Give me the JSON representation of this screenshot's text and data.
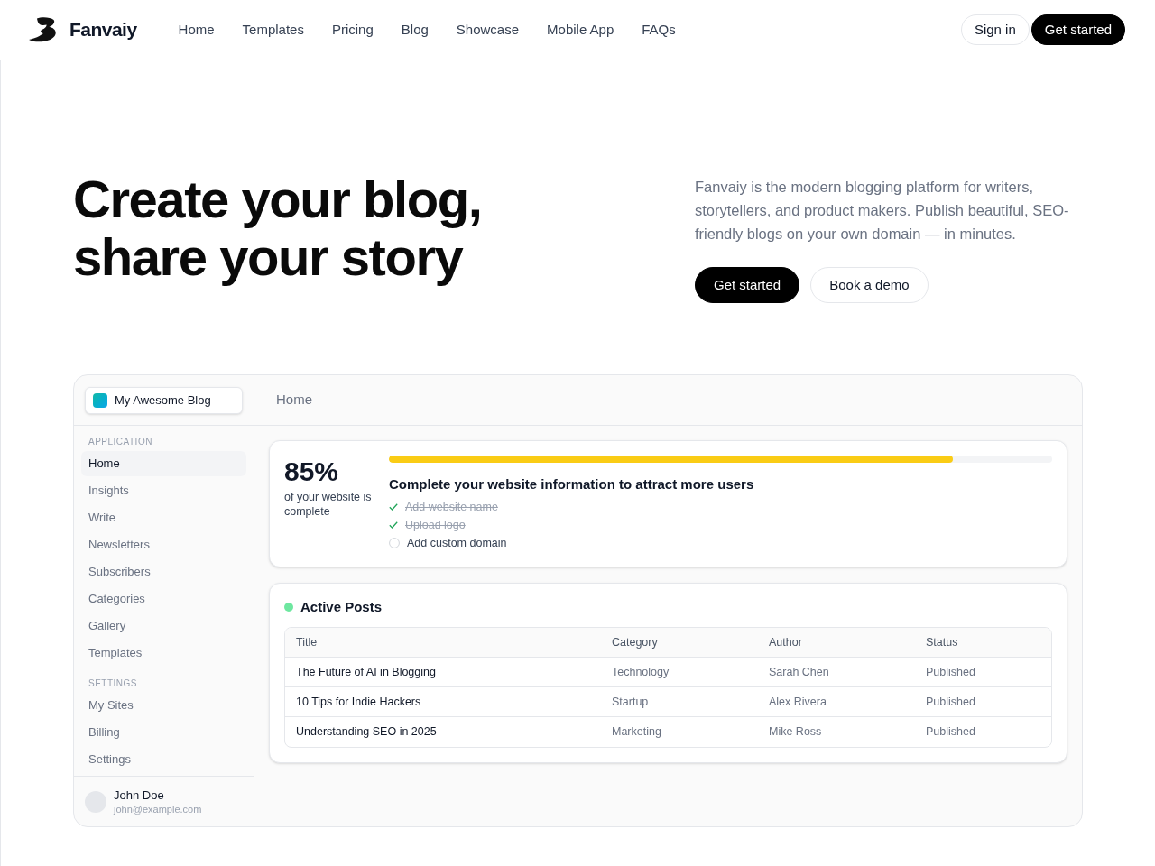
{
  "nav": {
    "brand": "Fanvaiy",
    "links": [
      "Home",
      "Templates",
      "Pricing",
      "Blog",
      "Showcase",
      "Mobile App",
      "FAQs"
    ],
    "actions": [
      {
        "label": "Sign in",
        "kind": "secondary"
      },
      {
        "label": "Get started",
        "kind": "primary"
      }
    ]
  },
  "hero": {
    "title_lines": [
      "Create your blog,",
      "share your story"
    ],
    "description": "Fanvaiy is the modern blogging platform for writers, storytellers, and product makers. Publish beautiful, SEO-friendly blogs on your own domain — in minutes.",
    "buttons": [
      {
        "label": "Get started",
        "kind": "primary"
      },
      {
        "label": "Book a demo",
        "kind": "secondary"
      }
    ]
  },
  "dashboard": {
    "site_picker": {
      "label": "My Awesome Blog"
    },
    "sidebar": {
      "sections": [
        {
          "heading": "APPLICATION",
          "items": [
            {
              "label": "Home",
              "selected": true
            },
            {
              "label": "Insights",
              "selected": false
            },
            {
              "label": "Write",
              "selected": false
            },
            {
              "label": "Newsletters",
              "selected": false
            },
            {
              "label": "Subscribers",
              "selected": false
            },
            {
              "label": "Categories",
              "selected": false
            },
            {
              "label": "Gallery",
              "selected": false
            },
            {
              "label": "Templates",
              "selected": false
            }
          ]
        },
        {
          "heading": "SETTINGS",
          "items": [
            {
              "label": "My Sites",
              "selected": false
            },
            {
              "label": "Billing",
              "selected": false
            },
            {
              "label": "Settings",
              "selected": false
            }
          ]
        }
      ],
      "user": {
        "name": "John Doe",
        "email": "john@example.com"
      }
    },
    "breadcrumb": "Home",
    "progress": {
      "percent": "85%",
      "caption": "of your website is complete",
      "level": 0.85,
      "title": "Complete your website information to attract more users",
      "tasks": [
        {
          "label": "Add website name",
          "checked": true
        },
        {
          "label": "Upload logo",
          "checked": true
        },
        {
          "label": "Add custom domain",
          "checked": false
        }
      ]
    },
    "posts": {
      "title": "Active Posts",
      "columns": [
        "Title",
        "Category",
        "Author",
        "Status"
      ],
      "rows": [
        [
          "The Future of AI in Blogging",
          "Technology",
          "Sarah Chen",
          "Published"
        ],
        [
          "10 Tips for Indie Hackers",
          "Startup",
          "Alex Rivera",
          "Published"
        ],
        [
          "Understanding SEO in 2025",
          "Marketing",
          "Mike Ross",
          "Published"
        ]
      ]
    }
  }
}
